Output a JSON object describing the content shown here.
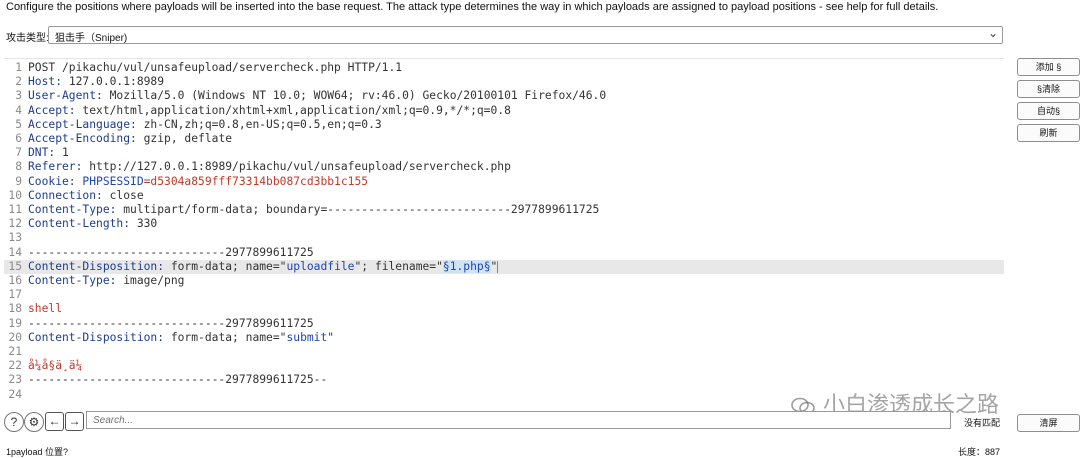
{
  "description": "Configure the positions where payloads will be inserted into the base request. The attack type determines the way in which payloads are assigned to payload positions - see help for full details.",
  "attack_type": {
    "label": "攻击类型:",
    "value": "狙击手（Sniper)"
  },
  "editor": {
    "lines": [
      {
        "n": "1",
        "parts": [
          {
            "t": "POST /pikachu/vul/unsafeupload/servercheck.php HTTP/1.1",
            "c": "v"
          }
        ]
      },
      {
        "n": "2",
        "parts": [
          {
            "t": "Host:",
            "c": "k"
          },
          {
            "t": " 127.0.0.1:8989",
            "c": "v"
          }
        ]
      },
      {
        "n": "3",
        "parts": [
          {
            "t": "User-Agent:",
            "c": "k"
          },
          {
            "t": " Mozilla/5.0 (Windows NT 10.0; WOW64; rv:46.0) Gecko/20100101 Firefox/46.0",
            "c": "v"
          }
        ]
      },
      {
        "n": "4",
        "parts": [
          {
            "t": "Accept:",
            "c": "k"
          },
          {
            "t": " text/html,application/xhtml+xml,application/xml;q=0.9,*/*;q=0.8",
            "c": "v"
          }
        ]
      },
      {
        "n": "5",
        "parts": [
          {
            "t": "Accept-Language:",
            "c": "k"
          },
          {
            "t": " zh-CN,zh;q=0.8,en-US;q=0.5,en;q=0.3",
            "c": "v"
          }
        ]
      },
      {
        "n": "6",
        "parts": [
          {
            "t": "Accept-Encoding:",
            "c": "k"
          },
          {
            "t": " gzip, deflate",
            "c": "v"
          }
        ]
      },
      {
        "n": "7",
        "parts": [
          {
            "t": "DNT:",
            "c": "k"
          },
          {
            "t": " 1",
            "c": "v"
          }
        ]
      },
      {
        "n": "8",
        "parts": [
          {
            "t": "Referer:",
            "c": "k"
          },
          {
            "t": " http://127.0.0.1:8989/pikachu/vul/unsafeupload/servercheck.php",
            "c": "v"
          }
        ]
      },
      {
        "n": "9",
        "parts": [
          {
            "t": "Cookie:",
            "c": "k"
          },
          {
            "t": " PHPSESSID",
            "c": "s"
          },
          {
            "t": "=d5304a859fff73314bb087cd3bb1c155",
            "c": "r"
          }
        ]
      },
      {
        "n": "10",
        "parts": [
          {
            "t": "Connection:",
            "c": "k"
          },
          {
            "t": " close",
            "c": "v"
          }
        ]
      },
      {
        "n": "11",
        "parts": [
          {
            "t": "Content-Type:",
            "c": "k"
          },
          {
            "t": " multipart/form-data; boundary=---------------------------2977899611725",
            "c": "v"
          }
        ]
      },
      {
        "n": "12",
        "parts": [
          {
            "t": "Content-Length:",
            "c": "k"
          },
          {
            "t": " 330",
            "c": "v"
          }
        ]
      },
      {
        "n": "13",
        "parts": []
      },
      {
        "n": "14",
        "parts": [
          {
            "t": "-----------------------------2977899611725",
            "c": "v"
          }
        ]
      },
      {
        "n": "15",
        "hl": true,
        "parts": [
          {
            "t": "Content-Disposition:",
            "c": "k"
          },
          {
            "t": " form-data; name=\"",
            "c": "v"
          },
          {
            "t": "uploadfile",
            "c": "s"
          },
          {
            "t": "\"; filename=\"",
            "c": "v"
          },
          {
            "t": "§1.php§",
            "c": "payload"
          },
          {
            "t": "\"",
            "c": "v"
          },
          {
            "t": "",
            "c": "cursor"
          }
        ]
      },
      {
        "n": "16",
        "parts": [
          {
            "t": "Content-Type:",
            "c": "k"
          },
          {
            "t": " image/png",
            "c": "v"
          }
        ]
      },
      {
        "n": "17",
        "parts": []
      },
      {
        "n": "18",
        "parts": [
          {
            "t": "shell",
            "c": "c"
          }
        ]
      },
      {
        "n": "19",
        "parts": [
          {
            "t": "-----------------------------2977899611725",
            "c": "v"
          }
        ]
      },
      {
        "n": "20",
        "parts": [
          {
            "t": "Content-Disposition:",
            "c": "k"
          },
          {
            "t": " form-data; name=\"",
            "c": "v"
          },
          {
            "t": "submit",
            "c": "s"
          },
          {
            "t": "\"",
            "c": "v"
          }
        ]
      },
      {
        "n": "21",
        "parts": []
      },
      {
        "n": "22",
        "parts": [
          {
            "t": "å¼å§ä¸ä¼ ",
            "c": "c"
          }
        ]
      },
      {
        "n": "23",
        "parts": [
          {
            "t": "-----------------------------2977899611725--",
            "c": "v"
          }
        ]
      },
      {
        "n": "24",
        "parts": []
      }
    ]
  },
  "side_buttons": {
    "add": "添加 §",
    "clear": "§清除",
    "auto": "自动§",
    "refresh": "刷新"
  },
  "search": {
    "placeholder": "Search...",
    "no_match": "没有匹配",
    "clear": "清屏"
  },
  "watermark": "小白渗透成长之路",
  "status": {
    "left": "1payload 位置?",
    "right": "长度：887"
  },
  "colors": {
    "key": "#1e3d8f",
    "string": "#1f45b5",
    "red": "#c0392b",
    "highlight_line": "#e8e8e8",
    "payload_bg": "#cfe3f5",
    "cursor": "#e37400"
  }
}
